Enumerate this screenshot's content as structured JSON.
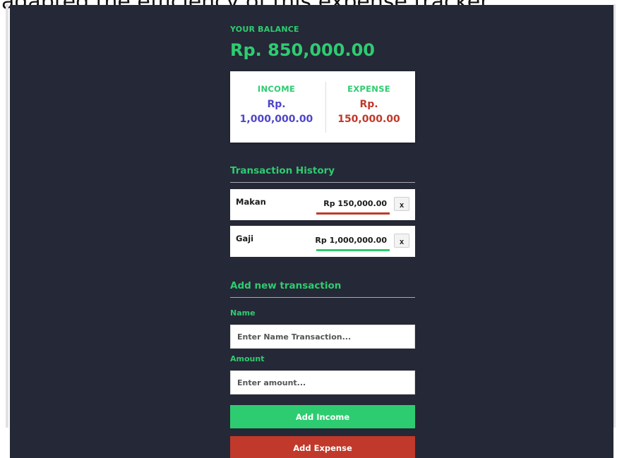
{
  "caption": "adapted the efficiency of this expense tracker.",
  "balance": {
    "label": "YOUR BALANCE",
    "value": "Rp. 850,000.00"
  },
  "summary": {
    "income": {
      "title": "INCOME",
      "amount_prefix": "Rp.",
      "amount": "1,000,000.00"
    },
    "expense": {
      "title": "EXPENSE",
      "amount_prefix": "Rp.",
      "amount": "150,000.00"
    }
  },
  "history": {
    "title": "Transaction History",
    "items": [
      {
        "name": "Makan",
        "amount": "Rp 150,000.00",
        "delete_label": "x",
        "type": "expense"
      },
      {
        "name": "Gaji",
        "amount": "Rp 1,000,000.00",
        "delete_label": "x",
        "type": "income"
      }
    ]
  },
  "form": {
    "title": "Add new transaction",
    "name_label": "Name",
    "name_placeholder": "Enter Name Transaction...",
    "amount_label": "Amount",
    "amount_placeholder": "Enter amount...",
    "add_income_label": "Add Income",
    "add_expense_label": "Add Expense"
  },
  "colors": {
    "background": "#252836",
    "income": "#2ecc71",
    "expense": "#c0392b",
    "income_amount": "#4f46c9"
  }
}
